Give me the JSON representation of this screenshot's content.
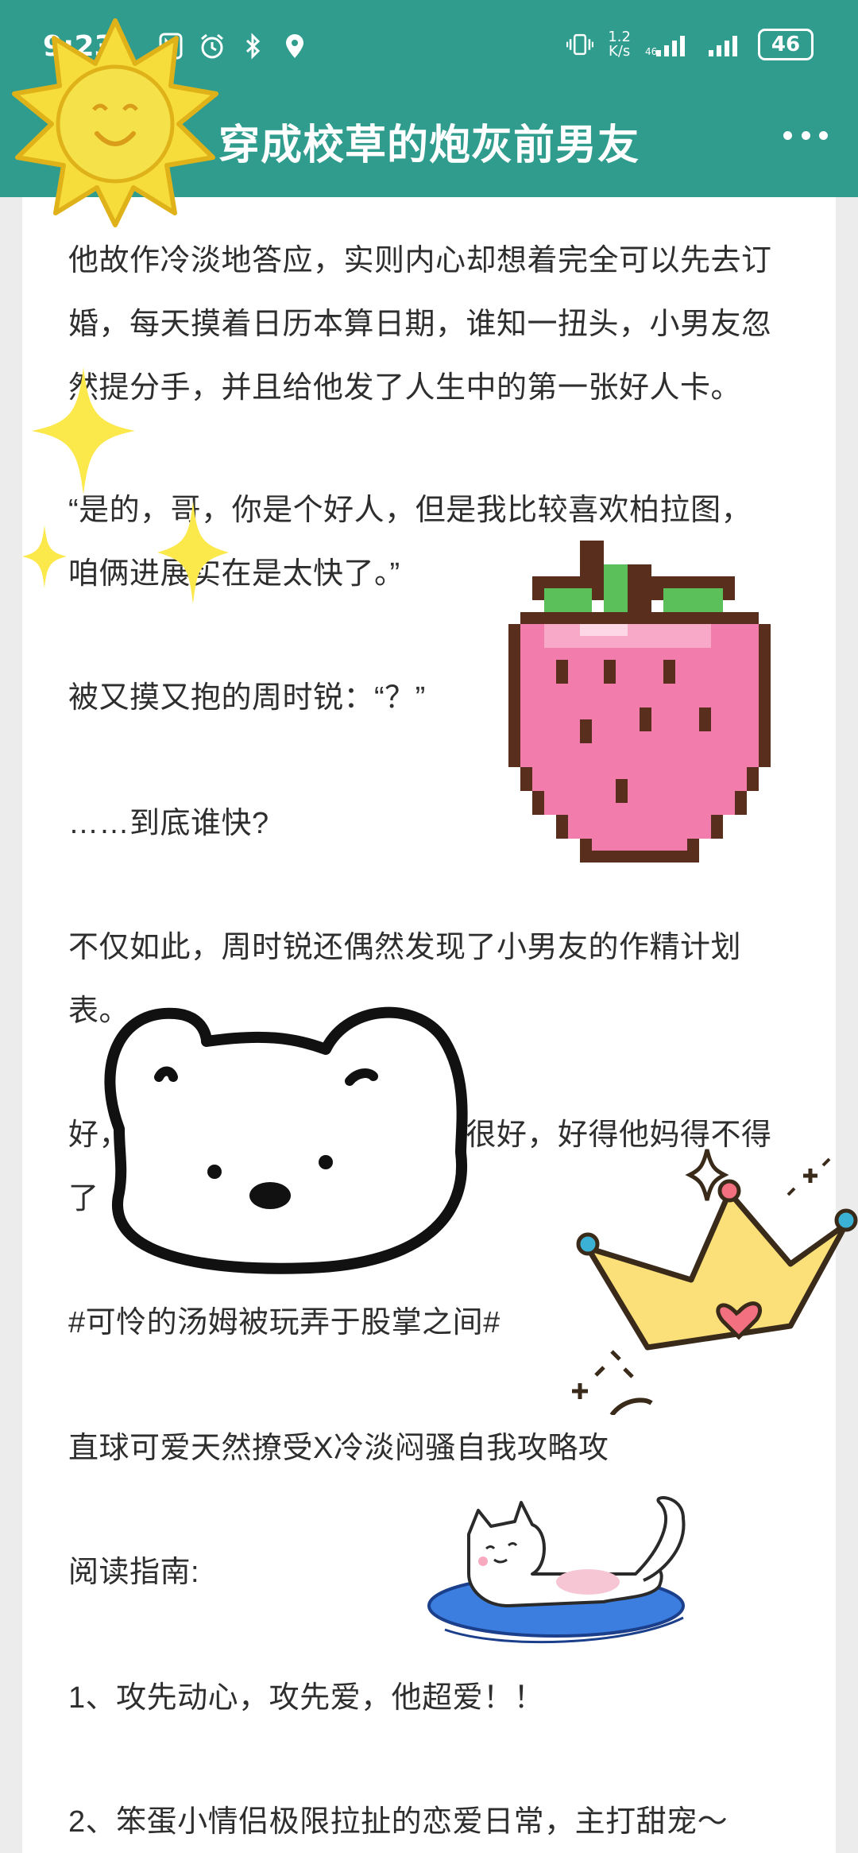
{
  "status_bar": {
    "time": "9:23",
    "net_speed_top": "1.2",
    "net_speed_bottom": "K/s",
    "battery": "46"
  },
  "header": {
    "title": "穿成校草的炮灰前男友"
  },
  "article": {
    "lines": [
      "他故作冷淡地答应，实则内心却想着完全可以先去订",
      "婚，每天摸着日历本算日期，谁知一扭头，小男友忽",
      "然提分手，并且给他发了人生中的第一张好人卡。",
      "“是的，哥，你是个好人，但是我比较喜欢柏拉图，",
      "咱俩进展实在是太快了。”",
      "被又摸又抱的周时锐：“？”",
      "……到底谁快?",
      "不仅如此，周时锐还偶然发现了小男友的作精计划",
      "表。",
      "好，周时锐磨了磨牙，他觉得很好，好得他妈得不得",
      "了",
      "#可怜的汤姆被玩弄于股掌之间#",
      "直球可爱天然撩受X冷淡闷骚自我攻略攻",
      "阅读指南:",
      "1、攻先动心，攻先爱，他超爱！！",
      "2、笨蛋小情侣极限拉扯的恋爱日常，主打甜宠～"
    ]
  },
  "colors": {
    "header_bg": "#2f9c8e",
    "page_bg": "#ffffff",
    "text": "#2e2e2e"
  }
}
